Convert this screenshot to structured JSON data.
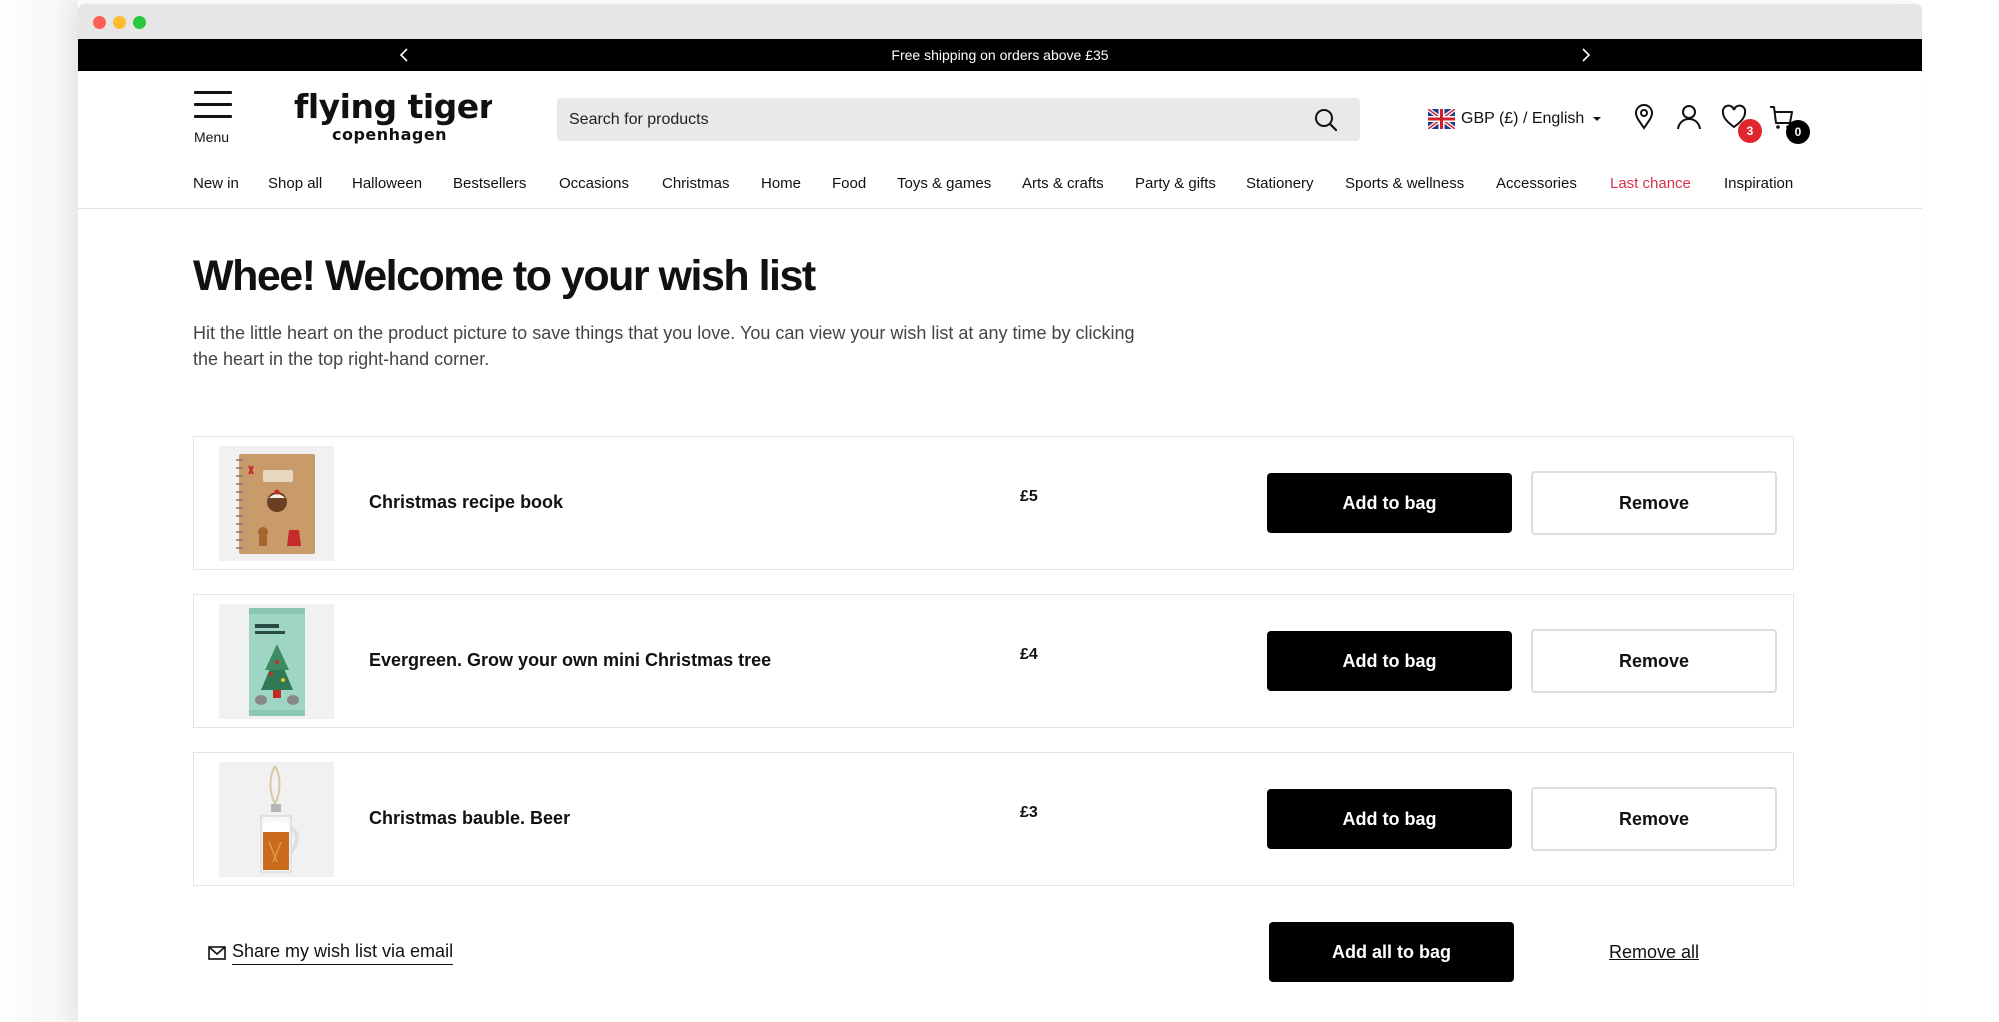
{
  "promo": {
    "text": "Free shipping on orders above £35",
    "prev_icon": "chevron-left-icon",
    "next_icon": "chevron-right-icon"
  },
  "header": {
    "menu_label": "Menu",
    "logo_line1": "flying tiger",
    "logo_line2": "copenhagen",
    "search_placeholder": "Search for products",
    "locale_label": "GBP (£) / English",
    "wishlist_count": "3",
    "bag_count": "0"
  },
  "nav": {
    "items": [
      {
        "label": "New in"
      },
      {
        "label": "Shop all"
      },
      {
        "label": "Halloween"
      },
      {
        "label": "Bestsellers"
      },
      {
        "label": "Occasions"
      },
      {
        "label": "Christmas"
      },
      {
        "label": "Home"
      },
      {
        "label": "Food"
      },
      {
        "label": "Toys & games"
      },
      {
        "label": "Arts & crafts"
      },
      {
        "label": "Party & gifts"
      },
      {
        "label": "Stationery"
      },
      {
        "label": "Sports & wellness"
      },
      {
        "label": "Accessories"
      },
      {
        "label": "Last chance"
      },
      {
        "label": "Inspiration"
      }
    ],
    "accent_color": "#d4334d"
  },
  "page": {
    "title": "Whee! Welcome to your wish list",
    "intro": "Hit the little heart on the product picture to save things that you love. You can view your wish list at any time by clicking the heart in the top right-hand corner."
  },
  "wishlist": {
    "items": [
      {
        "name": "Christmas recipe book",
        "price": "£5",
        "add_label": "Add to bag",
        "remove_label": "Remove"
      },
      {
        "name": "Evergreen. Grow your own mini Christmas tree",
        "price": "£4",
        "add_label": "Add to bag",
        "remove_label": "Remove"
      },
      {
        "name": "Christmas bauble. Beer",
        "price": "£3",
        "add_label": "Add to bag",
        "remove_label": "Remove"
      }
    ],
    "share_label": "Share my wish list via email",
    "add_all_label": "Add all to bag",
    "remove_all_label": "Remove all"
  },
  "colors": {
    "badge_red": "#e1262d",
    "button_black": "#000000"
  }
}
